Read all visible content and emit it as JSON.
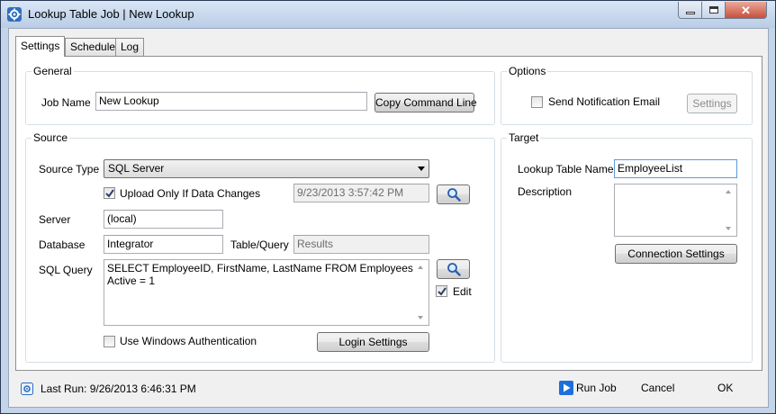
{
  "window": {
    "title": "Lookup Table Job | New Lookup"
  },
  "tabs": [
    {
      "label": "Settings"
    },
    {
      "label": "Schedule"
    },
    {
      "label": "Log"
    }
  ],
  "general": {
    "title": "General",
    "job_name_label": "Job Name",
    "job_name_value": "New Lookup",
    "copy_command_line_label": "Copy Command Line"
  },
  "options": {
    "title": "Options",
    "send_notification_label": "Send Notification Email",
    "send_notification_checked": false,
    "settings_label": "Settings"
  },
  "source": {
    "title": "Source",
    "source_type_label": "Source Type",
    "source_type_value": "SQL Server",
    "upload_only_label": "Upload Only If Data Changes",
    "upload_only_checked": true,
    "timestamp_value": "9/23/2013 3:57:42 PM",
    "server_label": "Server",
    "server_value": "(local)",
    "database_label": "Database",
    "database_value": "Integrator",
    "table_query_label": "Table/Query",
    "table_query_value": "Results",
    "sql_query_label": "SQL Query",
    "sql_query_line1": "SELECT EmployeeID, FirstName, LastName FROM Employees WHERE",
    "sql_query_line2": "Active = 1",
    "edit_label": "Edit",
    "edit_checked": true,
    "windows_auth_label": "Use Windows Authentication",
    "windows_auth_checked": false,
    "login_settings_label": "Login Settings"
  },
  "target": {
    "title": "Target",
    "lookup_table_name_label": "Lookup Table Name",
    "lookup_table_name_value": "EmployeeList",
    "description_label": "Description",
    "description_value": "",
    "connection_settings_label": "Connection Settings"
  },
  "footer": {
    "last_run": "Last Run: 9/26/2013 6:46:31 PM",
    "run_job_label": "Run Job",
    "cancel_label": "Cancel",
    "ok_label": "OK"
  },
  "icons": {
    "app": "gear-icon",
    "search": "magnifier-icon",
    "last_run": "status-icon",
    "run_job": "play-icon"
  },
  "colors": {
    "window_frame": "#c4d5ea",
    "close_button": "#c7503a",
    "run_job_icon": "#1e6fd9"
  }
}
